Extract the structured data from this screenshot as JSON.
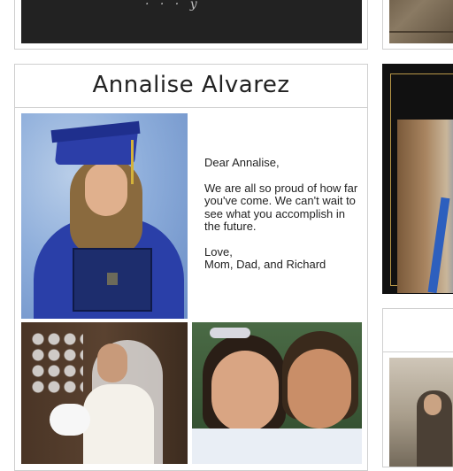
{
  "cards": {
    "top_left": {
      "banner_text": "· · · y"
    },
    "main": {
      "title": "Annalise Alvarez",
      "message": {
        "greeting": "Dear Annalise,",
        "body": "We are all so proud of how far you've come. We can't wait to see what you accomplish in the future.",
        "closing": "Love,",
        "signature": "Mom, Dad, and Richard"
      }
    }
  },
  "colors": {
    "border": "#cfcfcf",
    "dark_card": "#111111",
    "gold_frame": "#b89848",
    "gown_blue": "#2a3fa8"
  }
}
